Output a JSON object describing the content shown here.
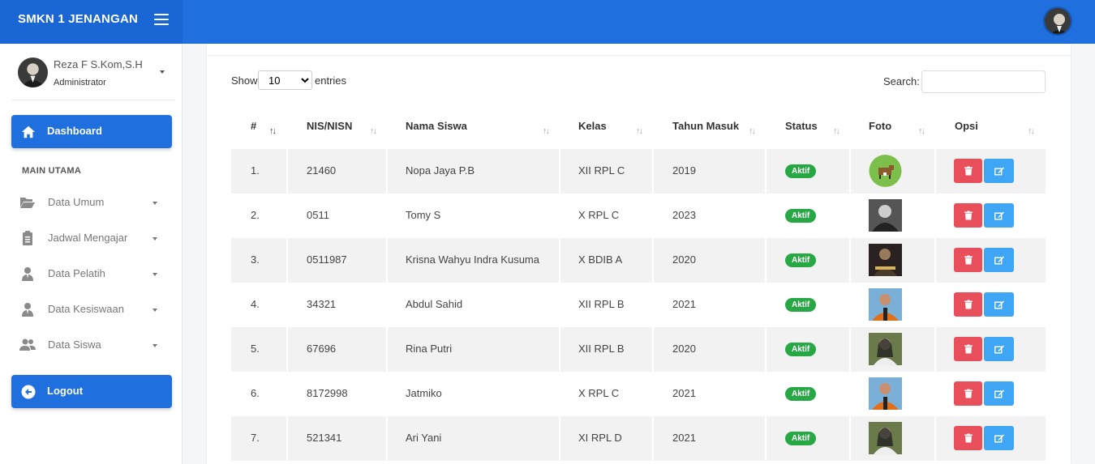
{
  "header": {
    "brand": "SMKN 1 JENANGAN"
  },
  "user": {
    "name": "Reza F S.Kom,S.H",
    "role": "Administrator"
  },
  "sidebar": {
    "dashboard": "Dashboard",
    "section": "MAIN UTAMA",
    "items": [
      {
        "label": "Data Umum",
        "icon": "folder-open-icon"
      },
      {
        "label": "Jadwal Mengajar",
        "icon": "clipboard-icon"
      },
      {
        "label": "Data Pelatih",
        "icon": "user-tie-icon"
      },
      {
        "label": "Data Kesiswaan",
        "icon": "user-tie-icon"
      },
      {
        "label": "Data Siswa",
        "icon": "users-icon"
      }
    ],
    "logout": "Logout"
  },
  "table_controls": {
    "show": "Show",
    "page_size": "10",
    "entries": "entries",
    "search_label": "Search:",
    "search_value": ""
  },
  "table": {
    "columns": [
      "#",
      "NIS/NISN",
      "Nama Siswa",
      "Kelas",
      "Tahun Masuk",
      "Status",
      "Foto",
      "Opsi"
    ],
    "rows": [
      {
        "no": "1.",
        "nis": "21460",
        "nama": "Nopa Jaya P.B",
        "kelas": "XII RPL C",
        "tahun": "2019",
        "status": "Aktif"
      },
      {
        "no": "2.",
        "nis": "0511",
        "nama": "Tomy S",
        "kelas": "X RPL C",
        "tahun": "2023",
        "status": "Aktif"
      },
      {
        "no": "3.",
        "nis": "0511987",
        "nama": "Krisna Wahyu Indra Kusuma",
        "kelas": "X BDIB A",
        "tahun": "2020",
        "status": "Aktif"
      },
      {
        "no": "4.",
        "nis": "34321",
        "nama": "Abdul Sahid",
        "kelas": "XII RPL B",
        "tahun": "2021",
        "status": "Aktif"
      },
      {
        "no": "5.",
        "nis": "67696",
        "nama": "Rina Putri",
        "kelas": "XII RPL B",
        "tahun": "2020",
        "status": "Aktif"
      },
      {
        "no": "6.",
        "nis": "8172998",
        "nama": "Jatmiko",
        "kelas": "X RPL C",
        "tahun": "2021",
        "status": "Aktif"
      },
      {
        "no": "7.",
        "nis": "521341",
        "nama": "Ari Yani",
        "kelas": "XI RPL D",
        "tahun": "2021",
        "status": "Aktif"
      }
    ]
  },
  "colors": {
    "primary": "#1f6fde",
    "success": "#28a745",
    "danger": "#e94e5b",
    "info": "#3ea6f5"
  }
}
